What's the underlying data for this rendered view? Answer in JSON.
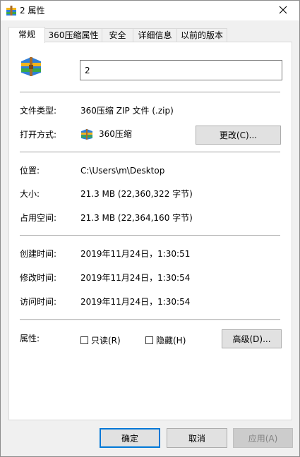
{
  "window": {
    "title": "2 属性",
    "close_icon": "close-icon"
  },
  "tabs": [
    {
      "label": "常规",
      "active": true
    },
    {
      "label": "360压缩属性"
    },
    {
      "label": "安全"
    },
    {
      "label": "详细信息"
    },
    {
      "label": "以前的版本"
    }
  ],
  "general": {
    "file_name": "2",
    "file_type_label": "文件类型:",
    "file_type_value": "360压缩 ZIP 文件 (.zip)",
    "open_with_label": "打开方式:",
    "open_with_value": "360压缩",
    "change_button": "更改(C)...",
    "location_label": "位置:",
    "location_value": "C:\\Users\\m\\Desktop",
    "size_label": "大小:",
    "size_value": "21.3 MB (22,360,322 字节)",
    "disk_size_label": "占用空间:",
    "disk_size_value": "21.3 MB (22,364,160 字节)",
    "created_label": "创建时间:",
    "created_value": "2019年11月24日，1:30:51",
    "modified_label": "修改时间:",
    "modified_value": "2019年11月24日，1:30:54",
    "accessed_label": "访问时间:",
    "accessed_value": "2019年11月24日，1:30:54",
    "attributes_label": "属性:",
    "readonly_label": "只读(R)",
    "hidden_label": "隐藏(H)",
    "advanced_button": "高级(D)..."
  },
  "footer": {
    "ok": "确定",
    "cancel": "取消",
    "apply": "应用(A)"
  },
  "colors": {
    "accent": "#0078d7",
    "archive_blue": "#1a6fd1",
    "archive_yellow": "#f2b51a",
    "archive_green": "#3aa84a"
  }
}
